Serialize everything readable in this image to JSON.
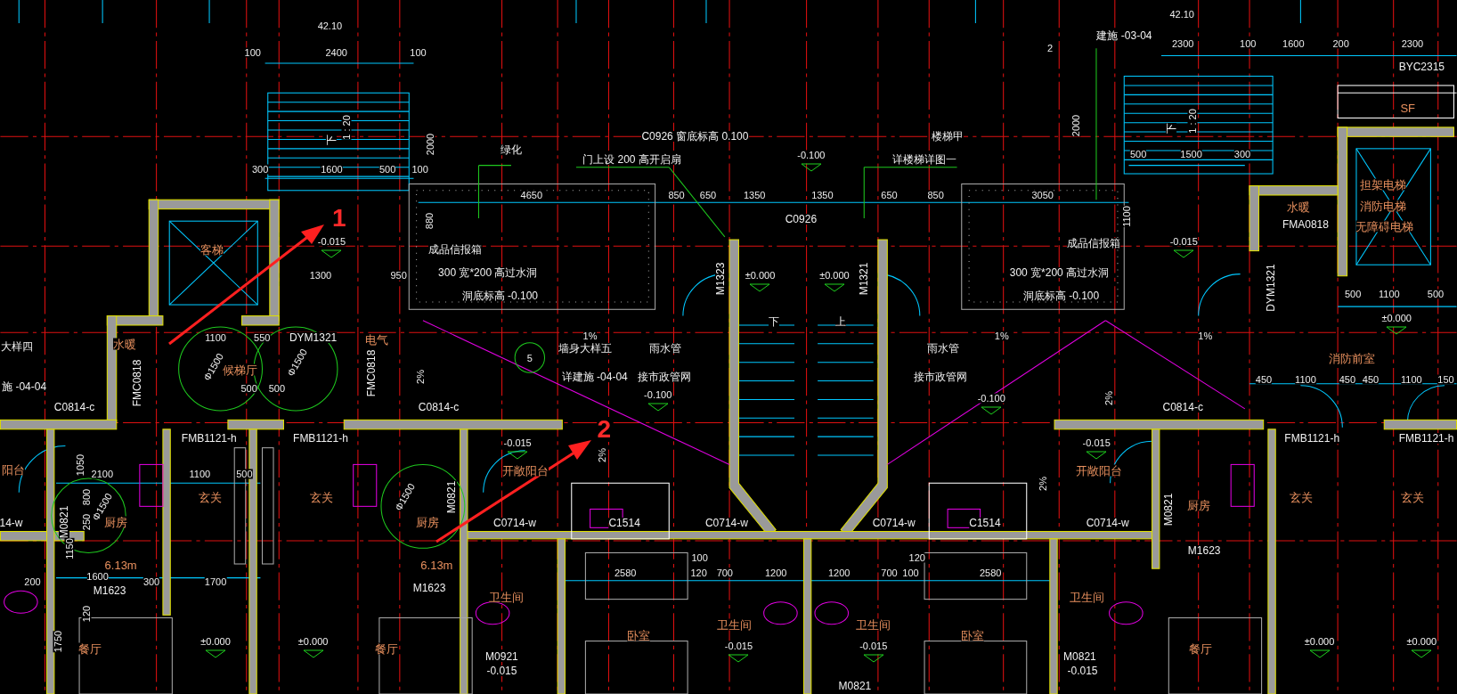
{
  "drawing": {
    "labels": [
      {
        "text": "42.10",
        "kind": "dim"
      },
      {
        "text": "100",
        "kind": "dim"
      },
      {
        "text": "2400",
        "kind": "dim"
      },
      {
        "text": "100",
        "kind": "dim"
      },
      {
        "text": "42.10",
        "kind": "dim"
      },
      {
        "text": "建施 -03-04",
        "kind": "note"
      },
      {
        "text": "2",
        "kind": "dim"
      },
      {
        "text": "2300",
        "kind": "dim"
      },
      {
        "text": "100",
        "kind": "dim"
      },
      {
        "text": "1600",
        "kind": "dim"
      },
      {
        "text": "200",
        "kind": "dim"
      },
      {
        "text": "2300",
        "kind": "dim"
      },
      {
        "text": "BYC2315",
        "kind": "code"
      },
      {
        "text": "SF",
        "kind": "room"
      },
      {
        "text": "1 : 20",
        "kind": "dim"
      },
      {
        "text": "下",
        "kind": "note"
      },
      {
        "text": "1 : 20",
        "kind": "dim"
      },
      {
        "text": "下",
        "kind": "note"
      },
      {
        "text": "2000",
        "kind": "dim"
      },
      {
        "text": "2000",
        "kind": "dim"
      },
      {
        "text": "300",
        "kind": "dim"
      },
      {
        "text": "1600",
        "kind": "dim"
      },
      {
        "text": "500",
        "kind": "dim"
      },
      {
        "text": "100",
        "kind": "dim"
      },
      {
        "text": "绿化",
        "kind": "note"
      },
      {
        "text": "C0926 窗底标高 0.100",
        "kind": "note"
      },
      {
        "text": "门上设 200 高开启扇",
        "kind": "note"
      },
      {
        "text": "-0.100",
        "kind": "elev"
      },
      {
        "text": "楼梯甲",
        "kind": "note"
      },
      {
        "text": "详楼梯详图一",
        "kind": "note"
      },
      {
        "text": "500",
        "kind": "dim"
      },
      {
        "text": "1500",
        "kind": "dim"
      },
      {
        "text": "300",
        "kind": "dim"
      },
      {
        "text": "4650",
        "kind": "dim"
      },
      {
        "text": "850",
        "kind": "dim"
      },
      {
        "text": "650",
        "kind": "dim"
      },
      {
        "text": "1350",
        "kind": "dim"
      },
      {
        "text": "1350",
        "kind": "dim"
      },
      {
        "text": "650",
        "kind": "dim"
      },
      {
        "text": "850",
        "kind": "dim"
      },
      {
        "text": "3050",
        "kind": "dim"
      },
      {
        "text": "880",
        "kind": "dim"
      },
      {
        "text": "1100",
        "kind": "dim"
      },
      {
        "text": "1",
        "kind": "callout"
      },
      {
        "text": "C0926",
        "kind": "code"
      },
      {
        "text": "-0.015",
        "kind": "elev"
      },
      {
        "text": "成品信报箱",
        "kind": "note"
      },
      {
        "text": "300 宽*200 高过水洞",
        "kind": "note"
      },
      {
        "text": "洞底标高 -0.100",
        "kind": "note"
      },
      {
        "text": "成品信报箱",
        "kind": "note"
      },
      {
        "text": "300 宽*200 高过水洞",
        "kind": "note"
      },
      {
        "text": "洞底标高 -0.100",
        "kind": "note"
      },
      {
        "text": "1300",
        "kind": "dim"
      },
      {
        "text": "950",
        "kind": "dim"
      },
      {
        "text": "M1323",
        "kind": "code"
      },
      {
        "text": "±0.000",
        "kind": "elev"
      },
      {
        "text": "±0.000",
        "kind": "elev"
      },
      {
        "text": "M1321",
        "kind": "code"
      },
      {
        "text": "-0.015",
        "kind": "elev"
      },
      {
        "text": "水暖",
        "kind": "room"
      },
      {
        "text": "FMA0818",
        "kind": "code"
      },
      {
        "text": "DYM1321",
        "kind": "code"
      },
      {
        "text": "担架电梯",
        "kind": "room"
      },
      {
        "text": "消防电梯",
        "kind": "room"
      },
      {
        "text": "无障碍电梯",
        "kind": "room"
      },
      {
        "text": "客梯",
        "kind": "room"
      },
      {
        "text": "500",
        "kind": "dim"
      },
      {
        "text": "1100",
        "kind": "dim"
      },
      {
        "text": "500",
        "kind": "dim"
      },
      {
        "text": "下",
        "kind": "note"
      },
      {
        "text": "上",
        "kind": "note"
      },
      {
        "text": "±0.000",
        "kind": "elev"
      },
      {
        "text": "1100",
        "kind": "dim"
      },
      {
        "text": "550",
        "kind": "dim"
      },
      {
        "text": "DYM1321",
        "kind": "code"
      },
      {
        "text": "电气",
        "kind": "room"
      },
      {
        "text": "1%",
        "kind": "dim"
      },
      {
        "text": "1%",
        "kind": "dim"
      },
      {
        "text": "1%",
        "kind": "dim"
      },
      {
        "text": "水暖",
        "kind": "room"
      },
      {
        "text": "FMC0818",
        "kind": "code"
      },
      {
        "text": "FMC0818",
        "kind": "code"
      },
      {
        "text": "候梯厅",
        "kind": "room"
      },
      {
        "text": "500",
        "kind": "dim"
      },
      {
        "text": "500",
        "kind": "dim"
      },
      {
        "text": "5",
        "kind": "dim"
      },
      {
        "text": "墙身大样五",
        "kind": "note"
      },
      {
        "text": "详建施 -04-04",
        "kind": "note"
      },
      {
        "text": "雨水管",
        "kind": "note"
      },
      {
        "text": "接市政管网",
        "kind": "note"
      },
      {
        "text": "-0.100",
        "kind": "elev"
      },
      {
        "text": "雨水管",
        "kind": "note"
      },
      {
        "text": "接市政管网",
        "kind": "note"
      },
      {
        "text": "-0.100",
        "kind": "elev"
      },
      {
        "text": "消防前室",
        "kind": "room"
      },
      {
        "text": "450",
        "kind": "dim"
      },
      {
        "text": "1100",
        "kind": "dim"
      },
      {
        "text": "450",
        "kind": "dim"
      },
      {
        "text": "450",
        "kind": "dim"
      },
      {
        "text": "1100",
        "kind": "dim"
      },
      {
        "text": "150",
        "kind": "dim"
      },
      {
        "text": "大样四",
        "kind": "note"
      },
      {
        "text": "施 -04-04",
        "kind": "note"
      },
      {
        "text": "C0814-c",
        "kind": "code"
      },
      {
        "text": "C0814-c",
        "kind": "code"
      },
      {
        "text": "C0814-c",
        "kind": "code"
      },
      {
        "text": "2%",
        "kind": "dim"
      },
      {
        "text": "2%",
        "kind": "dim"
      },
      {
        "text": "2%",
        "kind": "dim"
      },
      {
        "text": "2%",
        "kind": "dim"
      },
      {
        "text": "FMB1121-h",
        "kind": "code"
      },
      {
        "text": "FMB1121-h",
        "kind": "code"
      },
      {
        "text": "FMB1121-h",
        "kind": "code"
      },
      {
        "text": "FMB1121-h",
        "kind": "code"
      },
      {
        "text": "2",
        "kind": "callout"
      },
      {
        "text": "-0.015",
        "kind": "elev"
      },
      {
        "text": "-0.015",
        "kind": "elev"
      },
      {
        "text": "阳台",
        "kind": "room"
      },
      {
        "text": "1050",
        "kind": "dim"
      },
      {
        "text": "2100",
        "kind": "dim"
      },
      {
        "text": "1100",
        "kind": "dim"
      },
      {
        "text": "500",
        "kind": "dim"
      },
      {
        "text": "开敞阳台",
        "kind": "room"
      },
      {
        "text": "开敞阳台",
        "kind": "room"
      },
      {
        "text": "M0821",
        "kind": "code"
      },
      {
        "text": "800",
        "kind": "dim"
      },
      {
        "text": "250",
        "kind": "dim"
      },
      {
        "text": "1150",
        "kind": "dim"
      },
      {
        "text": "厨房",
        "kind": "room"
      },
      {
        "text": "6.13m",
        "kind": "room"
      },
      {
        "text": "玄关",
        "kind": "room"
      },
      {
        "text": "玄关",
        "kind": "room"
      },
      {
        "text": "玄关",
        "kind": "room"
      },
      {
        "text": "玄关",
        "kind": "room"
      },
      {
        "text": "M0821",
        "kind": "code"
      },
      {
        "text": "厨房",
        "kind": "room"
      },
      {
        "text": "6.13m",
        "kind": "room"
      },
      {
        "text": "14-w",
        "kind": "code"
      },
      {
        "text": "C0714-w",
        "kind": "code"
      },
      {
        "text": "C1514",
        "kind": "code"
      },
      {
        "text": "C0714-w",
        "kind": "code"
      },
      {
        "text": "C0714-w",
        "kind": "code"
      },
      {
        "text": "C1514",
        "kind": "code"
      },
      {
        "text": "C0714-w",
        "kind": "code"
      },
      {
        "text": "M0821",
        "kind": "code"
      },
      {
        "text": "厨房",
        "kind": "room"
      },
      {
        "text": "M1623",
        "kind": "code"
      },
      {
        "text": "200",
        "kind": "dim"
      },
      {
        "text": "1600",
        "kind": "dim"
      },
      {
        "text": "M1623",
        "kind": "code"
      },
      {
        "text": "300",
        "kind": "dim"
      },
      {
        "text": "1700",
        "kind": "dim"
      },
      {
        "text": "M1623",
        "kind": "code"
      },
      {
        "text": "2580",
        "kind": "dim"
      },
      {
        "text": "100",
        "kind": "dim"
      },
      {
        "text": "120",
        "kind": "dim"
      },
      {
        "text": "700",
        "kind": "dim"
      },
      {
        "text": "1200",
        "kind": "dim"
      },
      {
        "text": "1200",
        "kind": "dim"
      },
      {
        "text": "700",
        "kind": "dim"
      },
      {
        "text": "100",
        "kind": "dim"
      },
      {
        "text": "120",
        "kind": "dim"
      },
      {
        "text": "2580",
        "kind": "dim"
      },
      {
        "text": "卫生间",
        "kind": "room"
      },
      {
        "text": "卫生间",
        "kind": "room"
      },
      {
        "text": "卫生间",
        "kind": "room"
      },
      {
        "text": "卫生间",
        "kind": "room"
      },
      {
        "text": "卧室",
        "kind": "room"
      },
      {
        "text": "卧室",
        "kind": "room"
      },
      {
        "text": "-0.015",
        "kind": "elev"
      },
      {
        "text": "-0.015",
        "kind": "elev"
      },
      {
        "text": "M0921",
        "kind": "code"
      },
      {
        "text": "-0.015",
        "kind": "code"
      },
      {
        "text": "M0821",
        "kind": "code"
      },
      {
        "text": "-0.015",
        "kind": "code"
      },
      {
        "text": "M0821",
        "kind": "code"
      },
      {
        "text": "1750",
        "kind": "dim"
      },
      {
        "text": "餐厅",
        "kind": "room"
      },
      {
        "text": "餐厅",
        "kind": "room"
      },
      {
        "text": "餐厅",
        "kind": "room"
      },
      {
        "text": "±0.000",
        "kind": "elev"
      },
      {
        "text": "±0.000",
        "kind": "elev"
      },
      {
        "text": "±0.000",
        "kind": "elev"
      },
      {
        "text": "±0.000",
        "kind": "elev"
      },
      {
        "text": "120",
        "kind": "dim"
      },
      {
        "text": "Φ1500",
        "kind": "dim"
      },
      {
        "text": "Φ1500",
        "kind": "dim"
      },
      {
        "text": "Φ1500",
        "kind": "dim"
      },
      {
        "text": "Φ1500",
        "kind": "dim"
      }
    ]
  }
}
